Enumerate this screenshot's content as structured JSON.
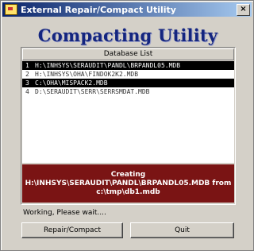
{
  "window": {
    "title": "External Repair/Compact Utility",
    "close_label": "×"
  },
  "heading": "Compacting Utility",
  "list": {
    "header": "Database List",
    "rows": [
      {
        "num": "1",
        "path": "H:\\INHSYS\\SERAUDIT\\PANDL\\BRPANDL05.MDB",
        "selected": true
      },
      {
        "num": "2",
        "path": "H:\\INHSYS\\OHA\\FINDOK2K2.MDB",
        "selected": false
      },
      {
        "num": "3",
        "path": "C:\\OHA\\MISPACK2.MDB",
        "selected": true
      },
      {
        "num": "4",
        "path": "D:\\SERAUDIT\\SERR\\SERRSMDAT.MDB",
        "selected": false
      }
    ]
  },
  "status": {
    "line1": "Creating",
    "line2": "H:\\INHSYS\\SERAUDIT\\PANDL\\BRPANDL05.MDB from",
    "line3": "c:\\tmp\\db1.mdb"
  },
  "working_text": "Working, Please wait....",
  "buttons": {
    "repair": "Repair/Compact",
    "quit": "Quit"
  },
  "colors": {
    "status_bg": "#7a1414",
    "heading": "#14257f",
    "titlebar": "#0a246a"
  }
}
